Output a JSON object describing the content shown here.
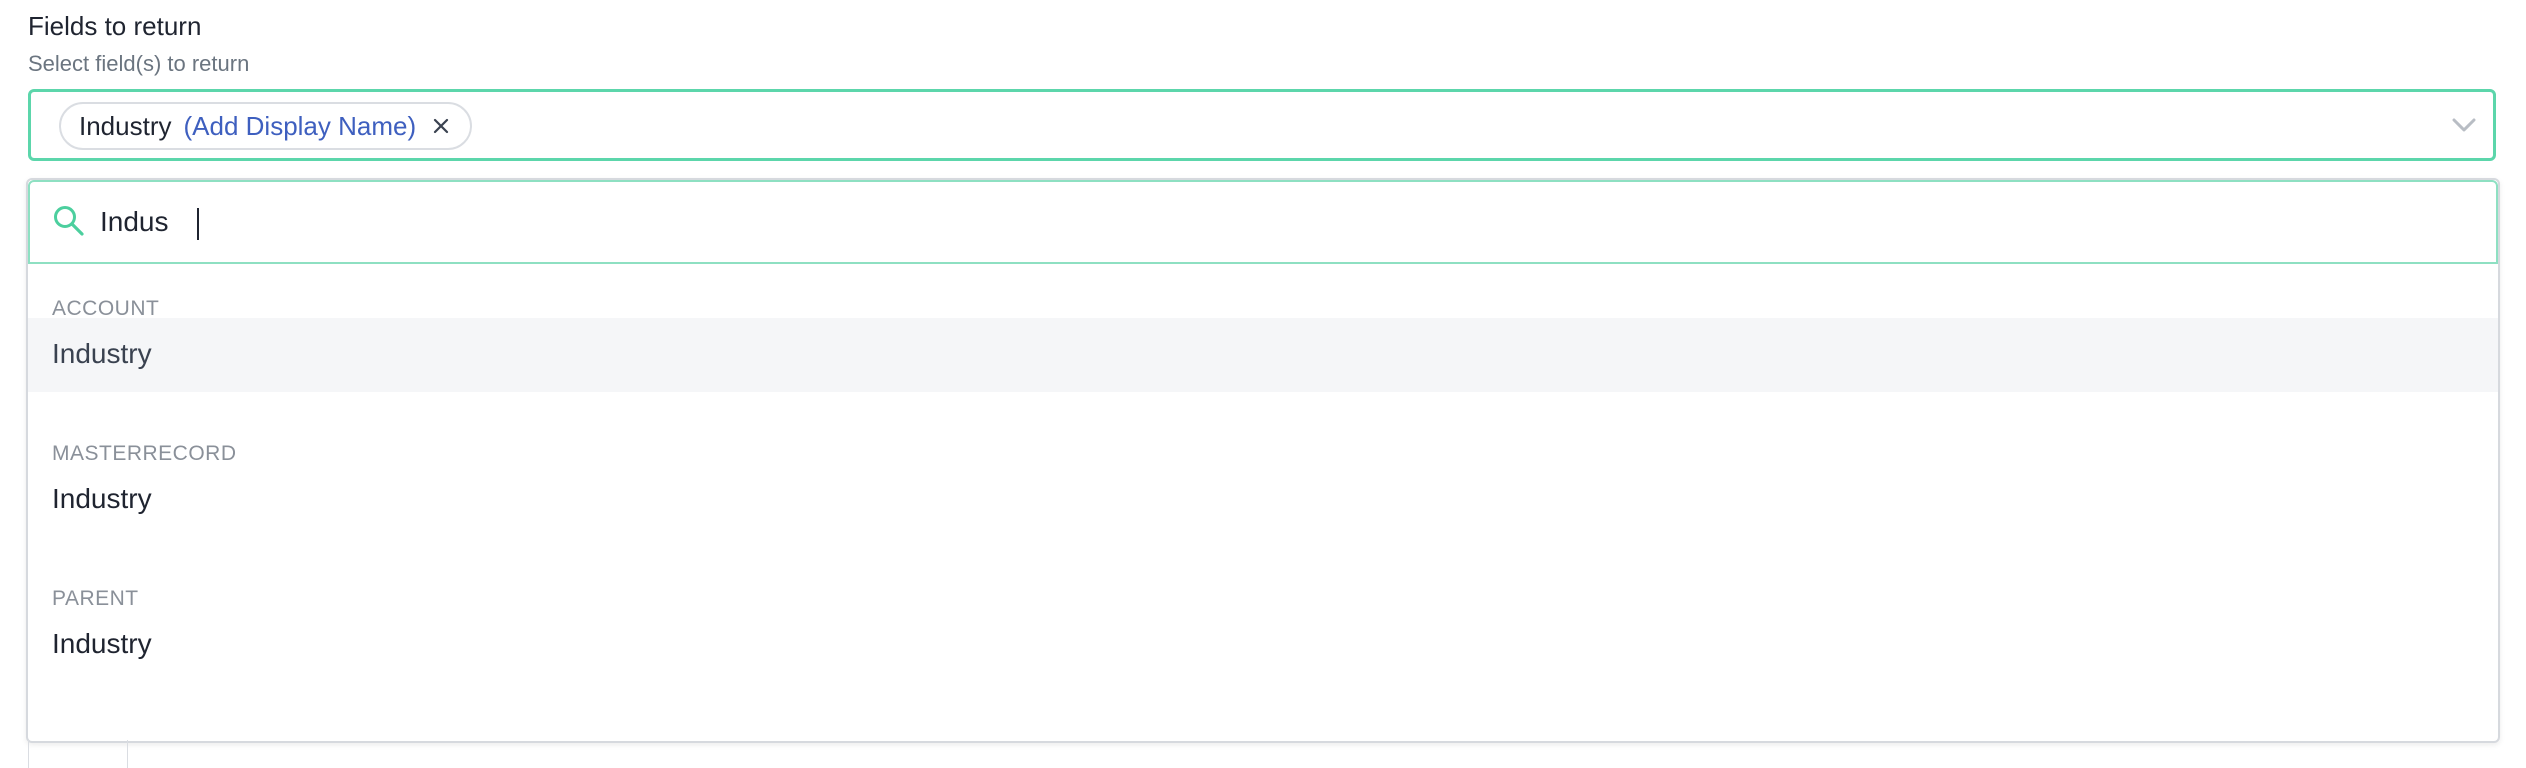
{
  "field": {
    "title": "Fields to return",
    "subtitle": "Select field(s) to return"
  },
  "selected_chip": {
    "label": "Industry",
    "action_link": "(Add Display Name)",
    "remove_icon": "close-icon"
  },
  "select": {
    "expand_icon": "chevron-down-icon"
  },
  "search": {
    "icon": "search-icon",
    "value": "Indus"
  },
  "groups": [
    {
      "label": "ACCOUNT",
      "options": [
        {
          "label": "Industry",
          "highlighted": true
        }
      ]
    },
    {
      "label": "MASTERRECORD",
      "options": [
        {
          "label": "Industry",
          "highlighted": false
        }
      ]
    },
    {
      "label": "PARENT",
      "options": [
        {
          "label": "Industry",
          "highlighted": false
        }
      ]
    }
  ],
  "colors": {
    "accent": "#5cd6ab",
    "link": "#3e5fbf",
    "highlight_row": "#f5f6f8",
    "group_label": "#8a9099"
  }
}
